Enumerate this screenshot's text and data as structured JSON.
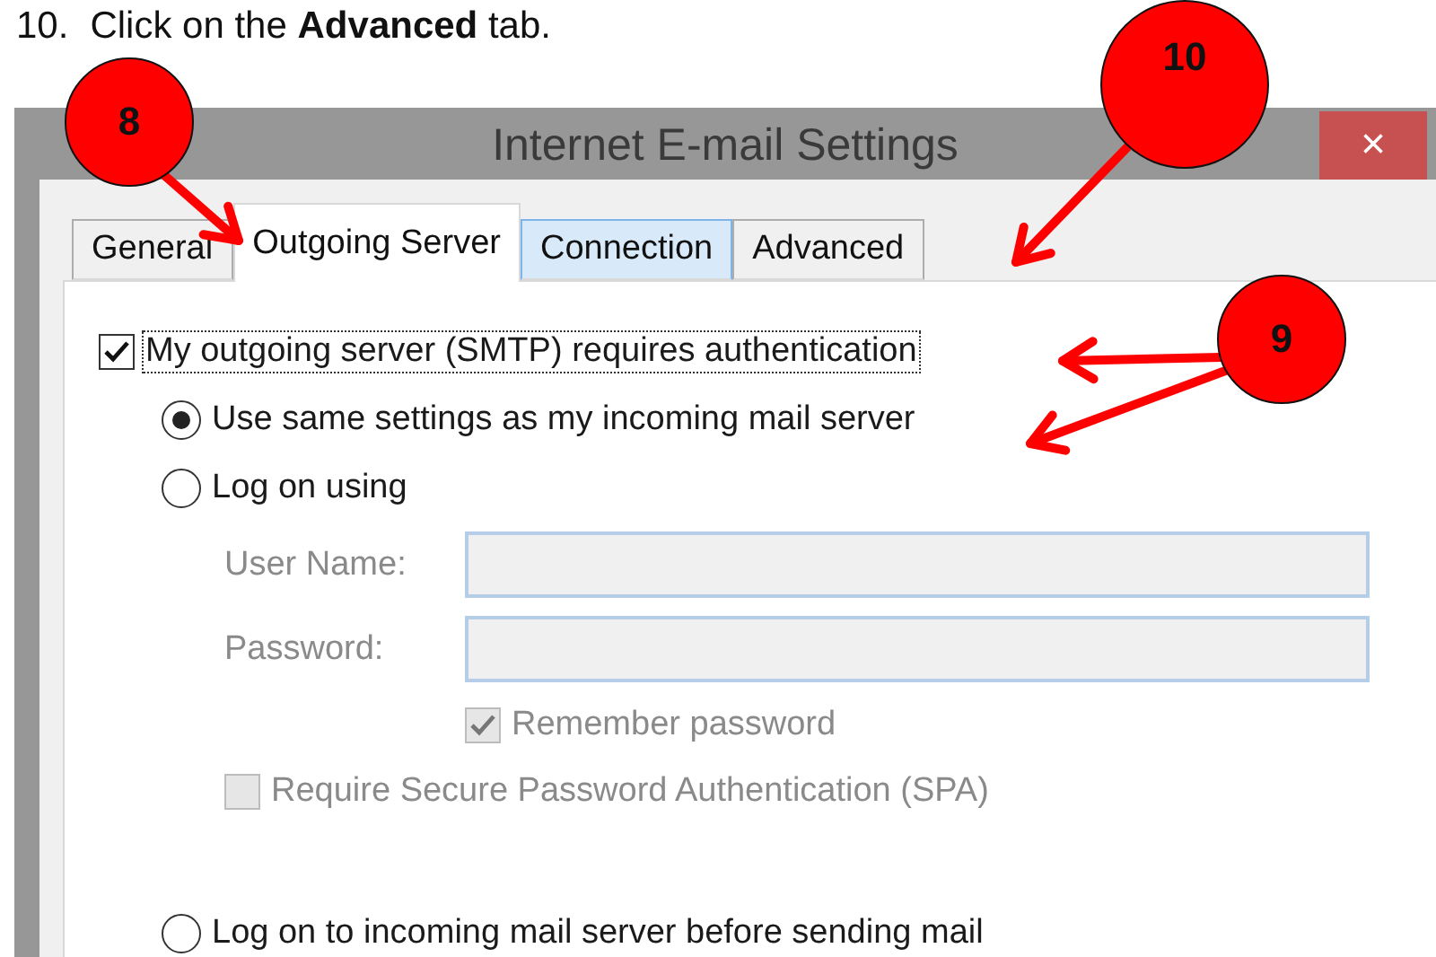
{
  "instruction": {
    "number": "10.",
    "text": "Click on the **Advanced** tab."
  },
  "window": {
    "title": "Internet E-mail Settings",
    "close": "×"
  },
  "tabs": [
    {
      "label": "General",
      "selected": false,
      "hovered": false
    },
    {
      "label": "Outgoing Server",
      "selected": true,
      "hovered": false
    },
    {
      "label": "Connection",
      "selected": false,
      "hovered": true
    },
    {
      "label": "Advanced",
      "selected": false,
      "hovered": false
    }
  ],
  "options": [
    {
      "kind": "checkbox",
      "label": "My outgoing server (SMTP) requires authentication",
      "checked": true,
      "disabled": false,
      "focused": true,
      "children": [
        {
          "kind": "radio",
          "label": "Use same settings as my incoming mail server",
          "selected": true,
          "disabled": false,
          "focused": false
        },
        {
          "kind": "radio",
          "label": "Log on using",
          "selected": false,
          "disabled": false,
          "focused": false,
          "children": [
            {
              "kind": "field",
              "label": "User Name:",
              "disabled": true
            },
            {
              "kind": "field",
              "label": "Password:",
              "disabled": true,
              "children": [
                {
                  "kind": "checkbox",
                  "label": "Remember password",
                  "checked": true,
                  "disabled": true,
                  "focused": false
                }
              ]
            },
            {
              "kind": "checkbox",
              "label": "Require Secure Password Authentication (SPA)",
              "checked": false,
              "disabled": true,
              "focused": false
            }
          ]
        },
        {
          "kind": "radio",
          "label": "Log on to incoming mail server before sending mail",
          "selected": false,
          "disabled": false,
          "focused": false
        }
      ]
    }
  ],
  "callouts": [
    {
      "label": "8"
    },
    {
      "label": "10"
    },
    {
      "label": "9"
    }
  ]
}
